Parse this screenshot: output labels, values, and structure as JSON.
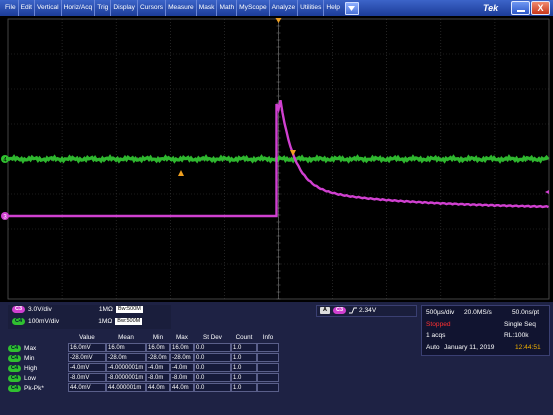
{
  "menu": [
    "File",
    "Edit",
    "Vertical",
    "Horiz/Acq",
    "Trig",
    "Display",
    "Cursors",
    "Measure",
    "Mask",
    "Math",
    "MyScope",
    "Analyze",
    "Utilities",
    "Help"
  ],
  "brand": "Tek",
  "window": {
    "minimize_icon": "minimize-icon",
    "close_label": "X"
  },
  "channels": [
    {
      "chip": "C3",
      "scale": "3.0V/div",
      "impedance": "1MΩ",
      "bw": "Bw:500M",
      "color": "#d040d0"
    },
    {
      "chip": "C4",
      "scale": "100mV/div",
      "impedance": "1MΩ",
      "bw": "Bw:500M",
      "color": "#30c030"
    }
  ],
  "trigger": {
    "chip_a": "A",
    "chip_src": "C3",
    "slope_icon": "rising-edge-icon",
    "level": "2.34V"
  },
  "acquisition": {
    "timebase": "500µs/div",
    "sample_rate": "20.0MS/s",
    "resolution": "50.0ns/pt",
    "status": "Stopped",
    "mode": "Single Seq",
    "acqs": "1 acqs",
    "record_length": "RL:100k",
    "trigger_mode": "Auto",
    "date": "January 11, 2019",
    "time": "12:44:51"
  },
  "measurements": {
    "headers": [
      "Value",
      "Mean",
      "Min",
      "Max",
      "St Dev",
      "Count",
      "Info"
    ],
    "rows": [
      {
        "chip": "C4",
        "name": "Max",
        "cells": [
          "16.0mV",
          "16.0m",
          "16.0m",
          "16.0m",
          "0.0",
          "1.0",
          ""
        ]
      },
      {
        "chip": "C4",
        "name": "Min",
        "cells": [
          "-28.0mV",
          "-28.0m",
          "-28.0m",
          "-28.0m",
          "0.0",
          "1.0",
          ""
        ]
      },
      {
        "chip": "C4",
        "name": "High",
        "cells": [
          "-4.0mV",
          "-4.0000001m",
          "-4.0m",
          "-4.0m",
          "0.0",
          "1.0",
          ""
        ]
      },
      {
        "chip": "C4",
        "name": "Low",
        "cells": [
          "-8.0mV",
          "-8.0000001m",
          "-8.0m",
          "-8.0m",
          "0.0",
          "1.0",
          ""
        ]
      },
      {
        "chip": "C4",
        "name": "Pk-Pk*",
        "cells": [
          "44.0mV",
          "44.000001m",
          "44.0m",
          "44.0m",
          "0.0",
          "1.0",
          ""
        ]
      }
    ]
  },
  "markers": {
    "ch4_label": "4",
    "ch3_label": "3"
  },
  "colors": {
    "grid": "#3a3a3a",
    "trace_ch3": "#d040d0",
    "trace_ch4": "#30c030",
    "trigger": "#f0a020",
    "status_stopped": "#ff3030",
    "time_color": "#f0b000"
  }
}
